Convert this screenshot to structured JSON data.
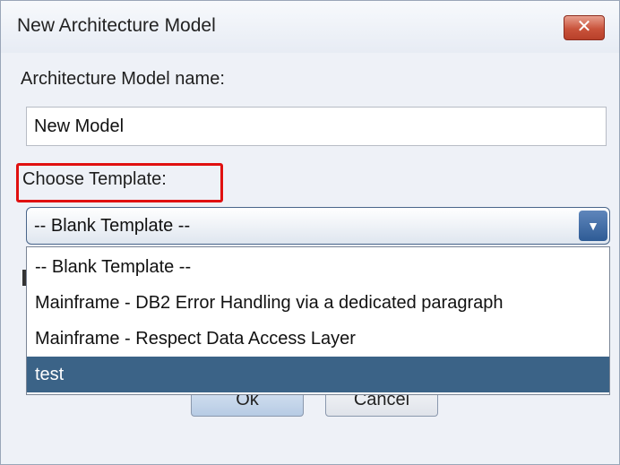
{
  "window": {
    "title": "New Architecture Model",
    "close_symbol": "✕"
  },
  "form": {
    "name_label": "Architecture Model name:",
    "name_value": "New Model",
    "template_label": "Choose Template:",
    "template_selected": "-- Blank Template --"
  },
  "dropdown": {
    "options": [
      "-- Blank Template --",
      "Mainframe - DB2 Error Handling via a dedicated paragraph",
      "Mainframe - Respect Data Access Layer",
      "test"
    ],
    "highlighted_option": "test"
  },
  "buttons": {
    "ok_label": "Ok",
    "cancel_label": "Cancel"
  },
  "colors": {
    "highlight_border": "#e01010",
    "selected_option_bg": "#3b6387",
    "close_button": "#c9533b"
  },
  "icons": {
    "close": "close-icon",
    "dropdown_arrow": "chevron-down-icon"
  }
}
